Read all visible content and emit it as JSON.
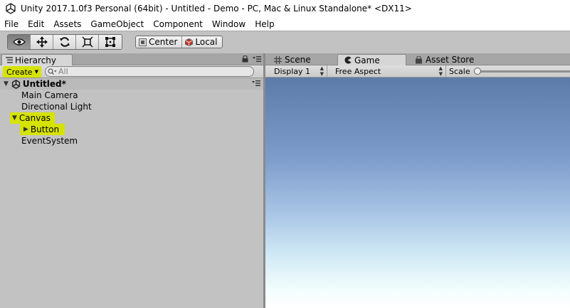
{
  "window": {
    "title": "Unity 2017.1.0f3 Personal (64bit) - Untitled - Demo - PC, Mac & Linux Standalone* <DX11>"
  },
  "menu": [
    "File",
    "Edit",
    "Assets",
    "GameObject",
    "Component",
    "Window",
    "Help"
  ],
  "toolbar": {
    "tools": [
      {
        "name": "view-tool",
        "icon": "eye-icon",
        "active": true
      },
      {
        "name": "move-tool",
        "icon": "move-arrows-icon",
        "active": false
      },
      {
        "name": "rotate-tool",
        "icon": "rotate-icon",
        "active": false
      },
      {
        "name": "scale-tool",
        "icon": "scale-icon",
        "active": false
      },
      {
        "name": "rect-tool",
        "icon": "rect-icon",
        "active": false
      }
    ],
    "pivot_label": "Center",
    "space_label": "Local"
  },
  "hierarchy": {
    "tab_label": "Hierarchy",
    "create_label": "Create",
    "search_placeholder": "All",
    "scene_name": "Untitled*",
    "items": [
      {
        "label": "Main Camera",
        "indent": 1,
        "expand": "",
        "highlight": false
      },
      {
        "label": "Directional Light",
        "indent": 1,
        "expand": "",
        "highlight": false
      },
      {
        "label": "Canvas",
        "indent": 0,
        "expand": "open",
        "highlight": true
      },
      {
        "label": "Button",
        "indent": 2,
        "expand": "closed",
        "highlight": true
      },
      {
        "label": "EventSystem",
        "indent": 1,
        "expand": "",
        "highlight": false
      }
    ]
  },
  "view_tabs": {
    "scene_label": "Scene",
    "game_label": "Game",
    "asset_store_label": "Asset Store",
    "active": "Game"
  },
  "game_toolbar": {
    "display_value": "Display 1",
    "aspect_value": "Free Aspect",
    "scale_label": "Scale"
  },
  "colors": {
    "highlight": "#d6e300",
    "sky_top": "#5d7ba8",
    "sky_horizon": "#ffffff"
  }
}
